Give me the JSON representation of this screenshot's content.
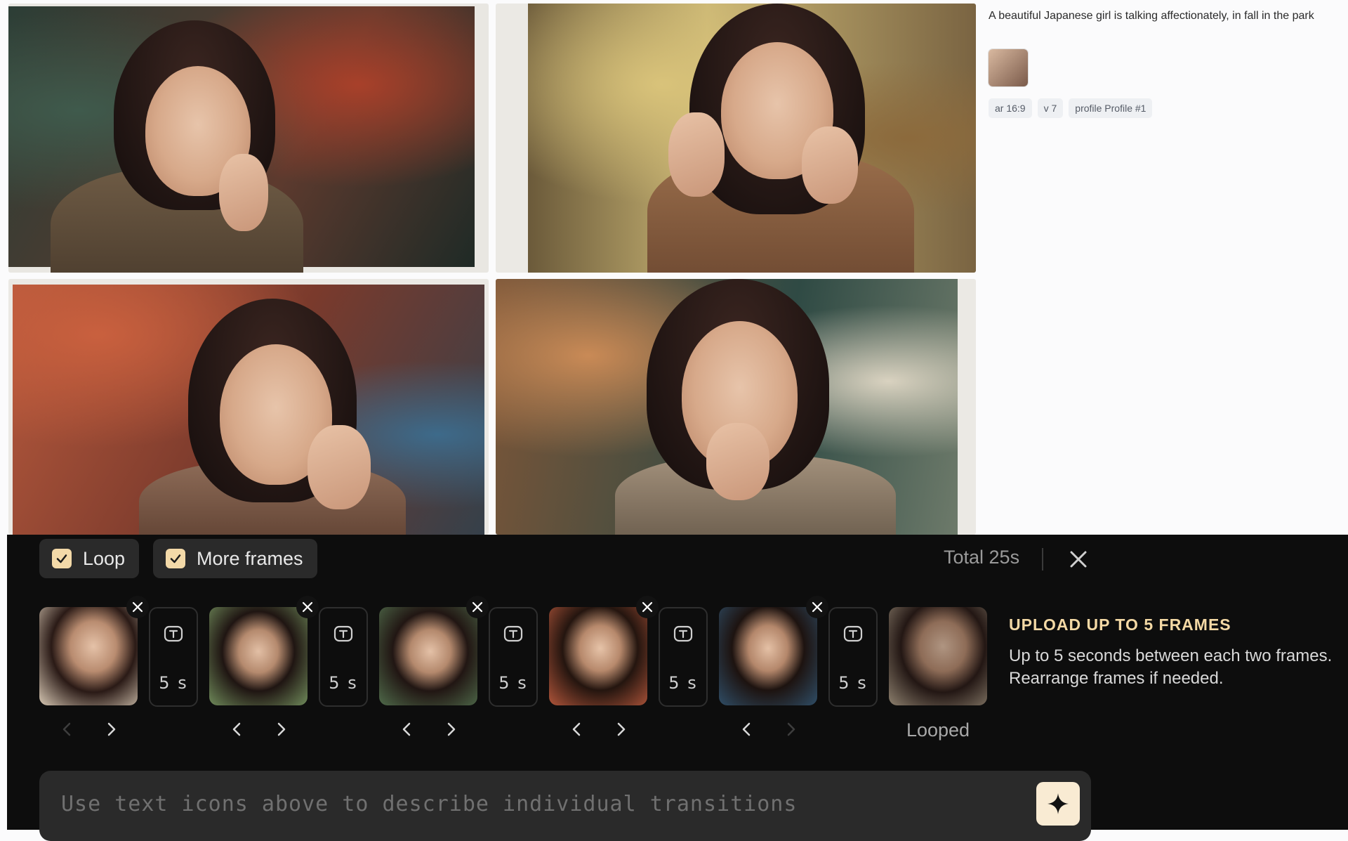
{
  "caption": "A beautiful Japanese girl is talking affectionately, in fall in the park",
  "chips": [
    "ar 16:9",
    "v 7",
    "profile Profile #1"
  ],
  "toolbar": {
    "loop_label": "Loop",
    "more_frames_label": "More frames",
    "total": "Total 25s"
  },
  "frames": [
    {
      "duration": "5 s"
    },
    {
      "duration": "5 s"
    },
    {
      "duration": "5 s"
    },
    {
      "duration": "5 s"
    },
    {
      "duration": "5 s"
    }
  ],
  "looped_label": "Looped",
  "upload": {
    "title": "UPLOAD UP TO 5 FRAMES",
    "line1": "Up to 5 seconds between each two frames.",
    "line2": "Rearrange frames if needed."
  },
  "prompt": {
    "placeholder": "Use text icons above to describe individual transitions"
  },
  "colors": {
    "accent": "#f3d9a8",
    "panel_bg": "#0d0d0d",
    "chip_bg": "#eef0f3"
  }
}
